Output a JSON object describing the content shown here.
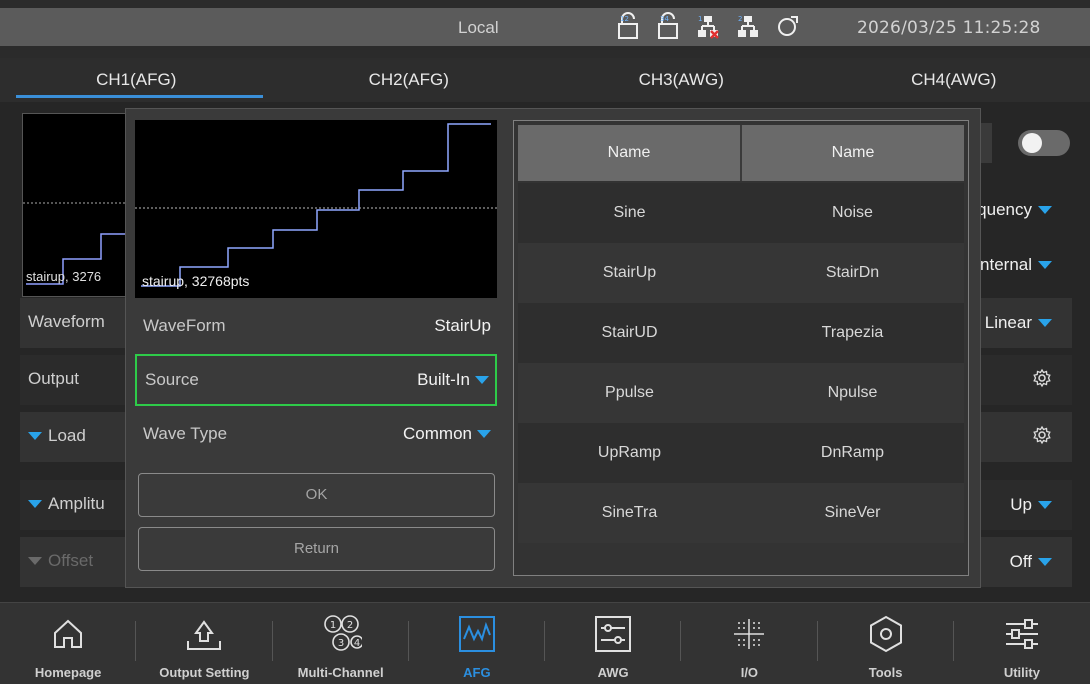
{
  "status": {
    "mode": "Local",
    "datetime": "2026/03/25 11:25:28",
    "icons": [
      "usb-12-icon",
      "usb-34-icon",
      "network-disconnected-icon",
      "network-connected-icon",
      "refresh-icon"
    ]
  },
  "tabs": [
    {
      "label": "CH1(AFG)",
      "active": true
    },
    {
      "label": "CH2(AFG)",
      "active": false
    },
    {
      "label": "CH3(AWG)",
      "active": false
    },
    {
      "label": "CH4(AWG)",
      "active": false
    }
  ],
  "background": {
    "wave_label": "stairup, 3276",
    "rows": [
      {
        "label": "Waveform",
        "value": "Linear"
      },
      {
        "label": "Output",
        "value": ""
      },
      {
        "label": "Load",
        "value": ""
      },
      {
        "label": "Amplitu",
        "value": "Up"
      },
      {
        "label": "Offset",
        "value": "Off"
      }
    ],
    "right_values": [
      "equency",
      "Internal"
    ]
  },
  "dialog": {
    "preview_label": "stairup, 32768pts",
    "waveform_label": "WaveForm",
    "waveform_value": "StairUp",
    "source_label": "Source",
    "source_value": "Built-In",
    "wavetype_label": "Wave Type",
    "wavetype_value": "Common",
    "ok_label": "OK",
    "return_label": "Return"
  },
  "table": {
    "headers": [
      "Name",
      "Name"
    ],
    "rows": [
      [
        "Sine",
        "Noise"
      ],
      [
        "StairUp",
        "StairDn"
      ],
      [
        "StairUD",
        "Trapezia"
      ],
      [
        "Ppulse",
        "Npulse"
      ],
      [
        "UpRamp",
        "DnRamp"
      ],
      [
        "SineTra",
        "SineVer"
      ]
    ]
  },
  "nav": [
    {
      "label": "Homepage",
      "icon": "home-icon"
    },
    {
      "label": "Output Setting",
      "icon": "output-setting-icon"
    },
    {
      "label": "Multi-Channel",
      "icon": "multi-channel-icon"
    },
    {
      "label": "AFG",
      "icon": "afg-icon",
      "active": true
    },
    {
      "label": "AWG",
      "icon": "awg-icon"
    },
    {
      "label": "I/O",
      "icon": "io-icon"
    },
    {
      "label": "Tools",
      "icon": "tools-icon"
    },
    {
      "label": "Utility",
      "icon": "utility-icon"
    }
  ],
  "colors": {
    "accent": "#2b8fe0",
    "focus": "#2ecb49",
    "dropdown": "#29a3ea"
  }
}
